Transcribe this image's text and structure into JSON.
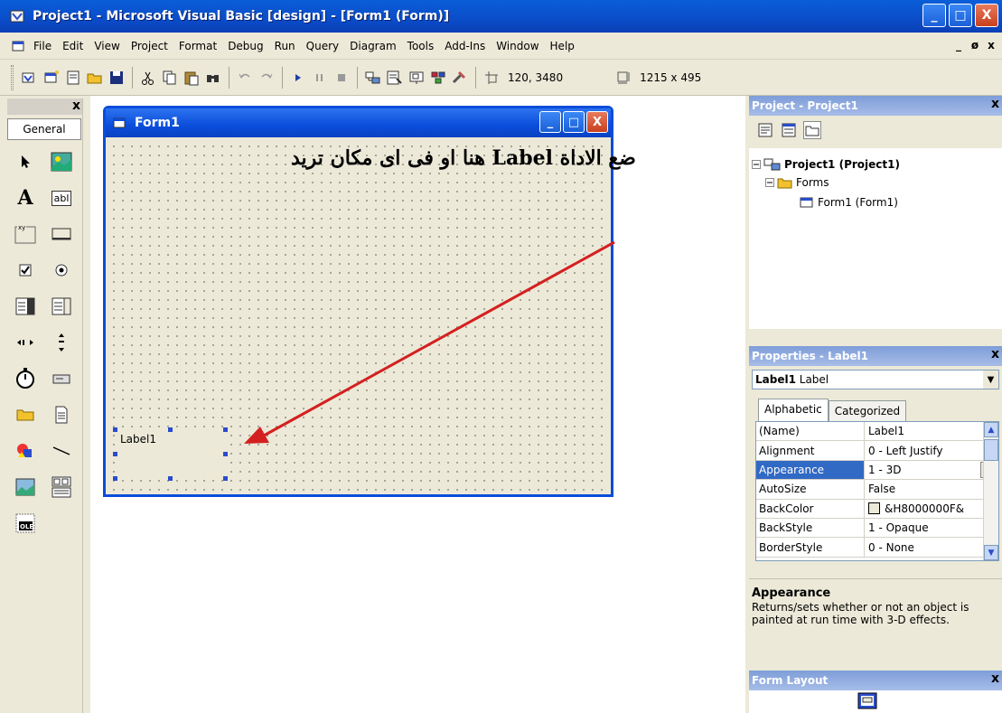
{
  "window": {
    "title": "Project1 - Microsoft Visual Basic [design] - [Form1 (Form)]",
    "minimize": "_",
    "maximize": "□",
    "close": "X"
  },
  "menu": {
    "items": [
      "File",
      "Edit",
      "View",
      "Project",
      "Format",
      "Debug",
      "Run",
      "Query",
      "Diagram",
      "Tools",
      "Add-Ins",
      "Window",
      "Help"
    ],
    "mdi_controls": [
      "_",
      "ø",
      "x"
    ]
  },
  "toolbar": {
    "position_readout": "120, 3480",
    "size_readout": "1215 x 495"
  },
  "toolbox": {
    "close": "x",
    "tab_label": "General",
    "text_tool_glyph": "A",
    "textbox_tool_label": "abl",
    "frame_tool_label": "xy"
  },
  "form": {
    "title": "Form1",
    "label_caption": "Label1",
    "annotation": "ضع الاداة Label هنا او فى اى مكان تريد"
  },
  "project_panel": {
    "title": "Project - Project1",
    "close": "x",
    "tree": {
      "root": "Project1 (Project1)",
      "folder": "Forms",
      "item": "Form1 (Form1)"
    }
  },
  "properties_panel": {
    "title": "Properties - Label1",
    "close": "x",
    "object_name": "Label1",
    "object_type": "Label",
    "tabs": [
      "Alphabetic",
      "Categorized"
    ],
    "rows": [
      {
        "name": "(Name)",
        "value": "Label1"
      },
      {
        "name": "Alignment",
        "value": "0 - Left Justify"
      },
      {
        "name": "Appearance",
        "value": "1 - 3D"
      },
      {
        "name": "AutoSize",
        "value": "False"
      },
      {
        "name": "BackColor",
        "value": "&H8000000F&"
      },
      {
        "name": "BackStyle",
        "value": "1 - Opaque"
      },
      {
        "name": "BorderStyle",
        "value": "0 - None"
      }
    ],
    "selected_row": "Appearance",
    "description_title": "Appearance",
    "description_text": "Returns/sets whether or not an object is painted at run time with 3-D effects."
  },
  "form_layout_panel": {
    "title": "Form Layout",
    "close": "x"
  },
  "colors": {
    "xp_blue": "#0a4ddb",
    "arrow_red": "#d42020",
    "selection": "#316ac5"
  }
}
